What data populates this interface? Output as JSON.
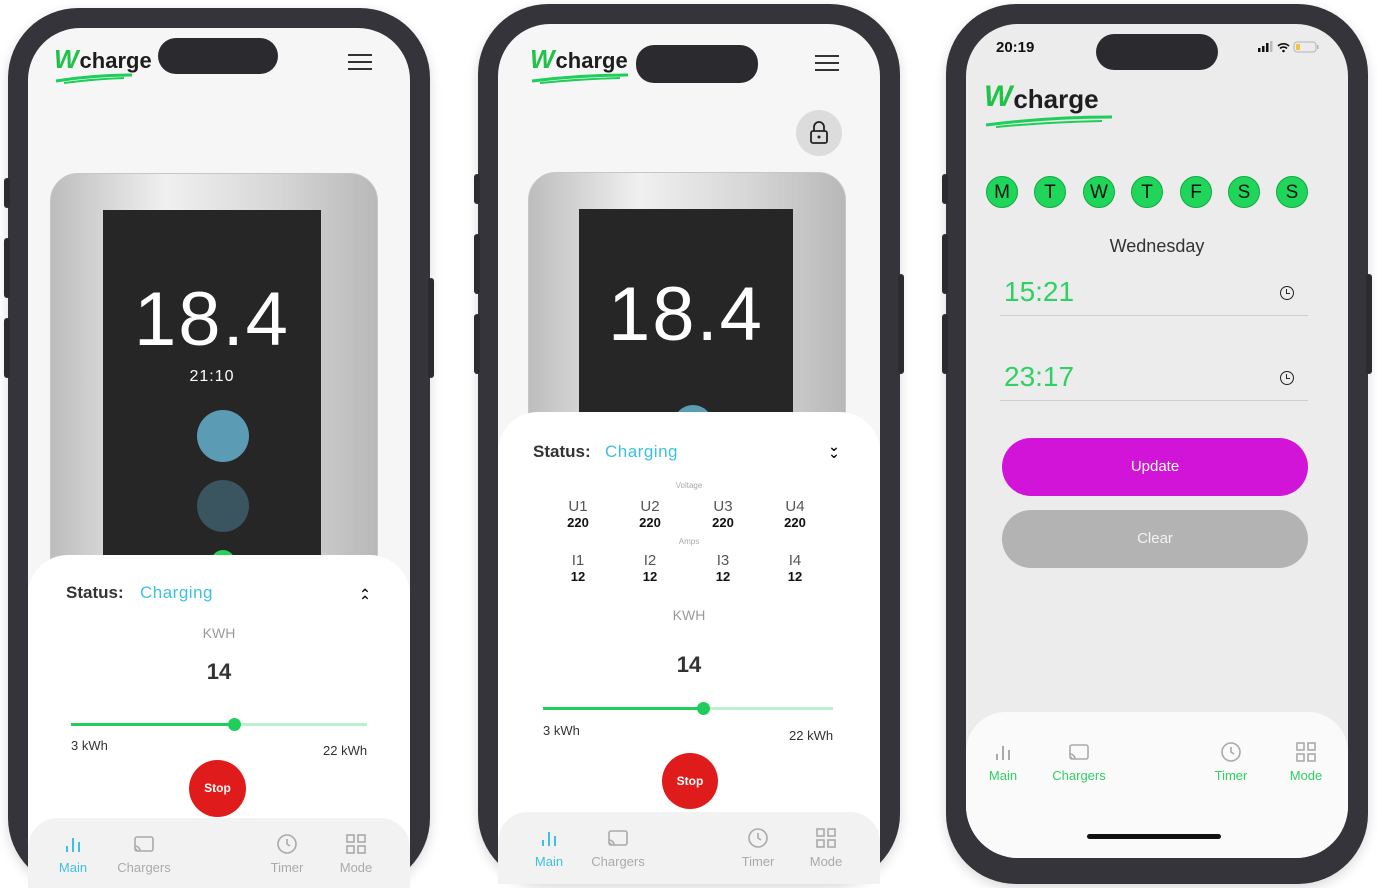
{
  "brand": {
    "logo_w": "W",
    "logo_text": "charge"
  },
  "screen1": {
    "reading": "18.4",
    "time": "21:10",
    "status_label": "Status:",
    "status_value": "Charging",
    "kwh_label": "KWH",
    "kwh_value": "14",
    "range_min": "3 kWh",
    "range_max": "22 kWh",
    "slider_fraction": 0.55,
    "stop_label": "Stop",
    "nav": {
      "main": "Main",
      "chargers": "Chargers",
      "timer": "Timer",
      "mode": "Mode"
    }
  },
  "screen2": {
    "reading": "18.4",
    "status_label": "Status:",
    "status_value": "Charging",
    "voltage_label": "Voltage",
    "amps_label": "Amps",
    "voltages": [
      {
        "name": "U1",
        "value": "220"
      },
      {
        "name": "U2",
        "value": "220"
      },
      {
        "name": "U3",
        "value": "220"
      },
      {
        "name": "U4",
        "value": "220"
      }
    ],
    "currents": [
      {
        "name": "I1",
        "value": "12"
      },
      {
        "name": "I2",
        "value": "12"
      },
      {
        "name": "I3",
        "value": "12"
      },
      {
        "name": "I4",
        "value": "12"
      }
    ],
    "kwh_label": "KWH",
    "kwh_value": "14",
    "range_min": "3 kWh",
    "range_max": "22 kWh",
    "slider_fraction": 0.55,
    "stop_label": "Stop",
    "nav": {
      "main": "Main",
      "chargers": "Chargers",
      "timer": "Timer",
      "mode": "Mode"
    }
  },
  "screen3": {
    "status_time": "20:19",
    "days": [
      "M",
      "T",
      "W",
      "T",
      "F",
      "S",
      "S"
    ],
    "day_title": "Wednesday",
    "start_time": "15:21",
    "end_time": "23:17",
    "update_label": "Update",
    "clear_label": "Clear",
    "nav": {
      "main": "Main",
      "chargers": "Chargers",
      "timer": "Timer",
      "mode": "Mode"
    }
  },
  "colors": {
    "brand_green": "#1fcd5a",
    "status_blue": "#3ec1e0",
    "stop_red": "#e01b1b",
    "update_magenta": "#d214d8",
    "clear_gray": "#b3b3b3"
  }
}
